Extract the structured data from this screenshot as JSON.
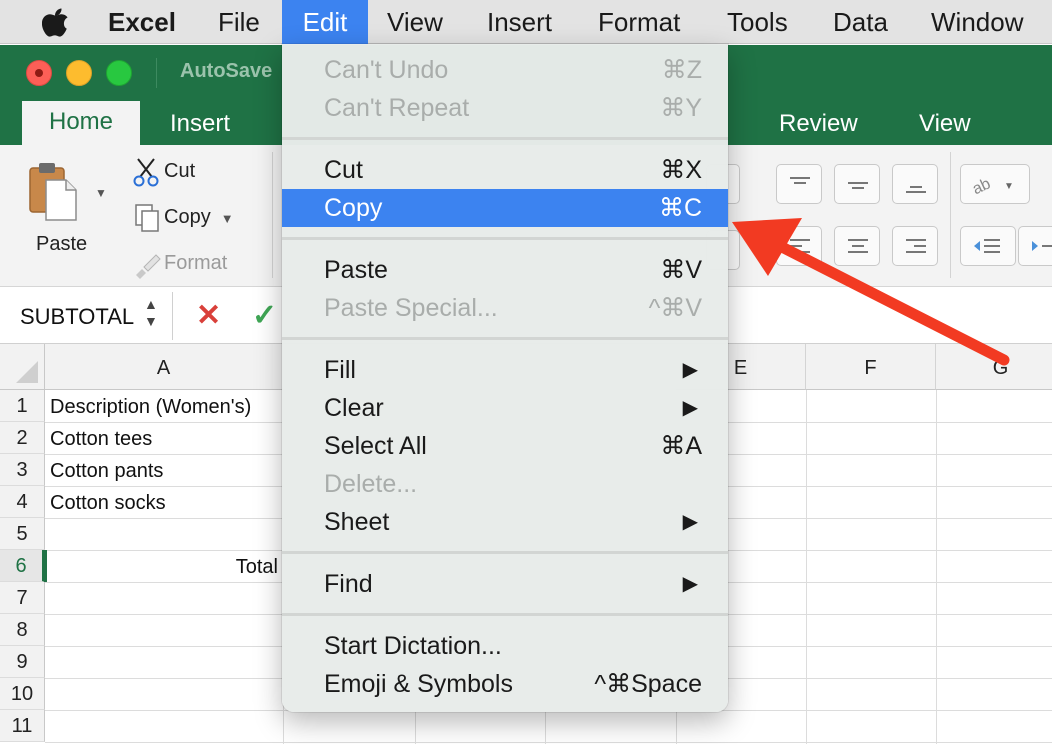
{
  "menubar": {
    "app": "Excel",
    "items": [
      "File",
      "Edit",
      "View",
      "Insert",
      "Format",
      "Tools",
      "Data",
      "Window"
    ]
  },
  "window": {
    "autosave": "AutoSave"
  },
  "ribbon": {
    "tabs": [
      "Home",
      "Insert",
      "Review",
      "View"
    ],
    "paste_label": "Paste",
    "cut_label": "Cut",
    "copy_label": "Copy",
    "format_label": "Format"
  },
  "formula_bar": {
    "name_box": "SUBTOTAL"
  },
  "grid": {
    "columns": [
      "A",
      "E",
      "F",
      "G"
    ],
    "rows": [
      "1",
      "2",
      "3",
      "4",
      "5",
      "6",
      "7",
      "8",
      "9",
      "10",
      "11"
    ],
    "cells": {
      "a1": "Description (Women's)",
      "a2": "Cotton tees",
      "a3": "Cotton pants",
      "a4": "Cotton socks",
      "a6": "Total"
    }
  },
  "edit_menu": {
    "undo": {
      "label": "Can't Undo",
      "shortcut": "⌘Z"
    },
    "repeat": {
      "label": "Can't Repeat",
      "shortcut": "⌘Y"
    },
    "cut": {
      "label": "Cut",
      "shortcut": "⌘X"
    },
    "copy": {
      "label": "Copy",
      "shortcut": "⌘C"
    },
    "paste": {
      "label": "Paste",
      "shortcut": "⌘V"
    },
    "paste_special": {
      "label": "Paste Special...",
      "shortcut": "^⌘V"
    },
    "fill": {
      "label": "Fill"
    },
    "clear": {
      "label": "Clear"
    },
    "select_all": {
      "label": "Select All",
      "shortcut": "⌘A"
    },
    "delete": {
      "label": "Delete..."
    },
    "sheet": {
      "label": "Sheet"
    },
    "find": {
      "label": "Find"
    },
    "dictation": {
      "label": "Start Dictation..."
    },
    "emoji": {
      "label": "Emoji & Symbols",
      "shortcut": "^⌘Space"
    }
  },
  "colors": {
    "excel_green": "#1f7245",
    "menu_highlight": "#3c83f0",
    "annotation_arrow": "#f23a22"
  }
}
